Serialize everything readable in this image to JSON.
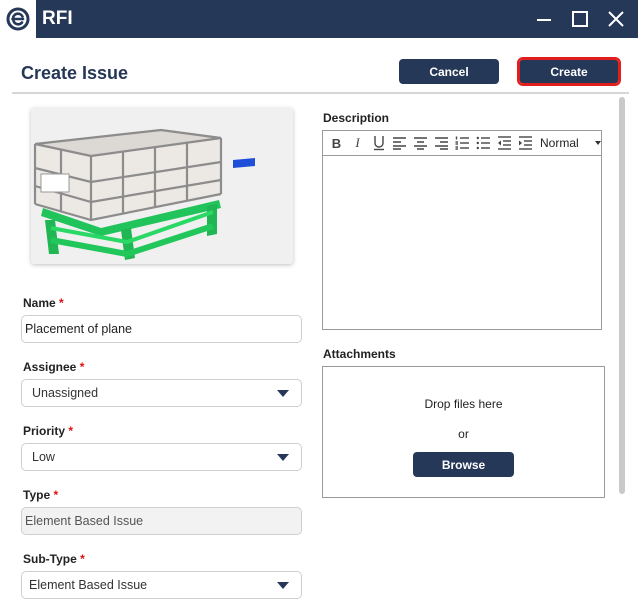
{
  "window": {
    "title": "RFI",
    "logo_icon": "app-logo-icon",
    "controls": [
      "minimize-icon",
      "maximize-icon",
      "close-icon"
    ],
    "titlebar_color": "#253858"
  },
  "header": {
    "title": "Create Issue",
    "cancel_label": "Cancel",
    "create_label": "Create",
    "accent_color": "#253858",
    "highlight_color": "#e01e1e"
  },
  "form": {
    "name": {
      "label": "Name",
      "required": "*",
      "value": "Placement of plane"
    },
    "assignee": {
      "label": "Assignee",
      "required": "*",
      "value": "Unassigned"
    },
    "priority": {
      "label": "Priority",
      "required": "*",
      "value": "Low"
    },
    "type": {
      "label": "Type",
      "required": "*",
      "value": "Element Based Issue"
    },
    "subtype": {
      "label": "Sub-Type",
      "required": "*",
      "value": "Element Based Issue"
    }
  },
  "description": {
    "label": "Description",
    "format_value": "Normal",
    "toolbar_icons": [
      "bold-icon",
      "italic-icon",
      "underline-icon",
      "align-left-icon",
      "align-center-icon",
      "align-right-icon",
      "ordered-list-icon",
      "bullet-list-icon",
      "outdent-icon",
      "indent-icon"
    ],
    "text": ""
  },
  "attachments": {
    "label": "Attachments",
    "drop_text": "Drop files here",
    "or_text": "or",
    "browse_label": "Browse"
  }
}
